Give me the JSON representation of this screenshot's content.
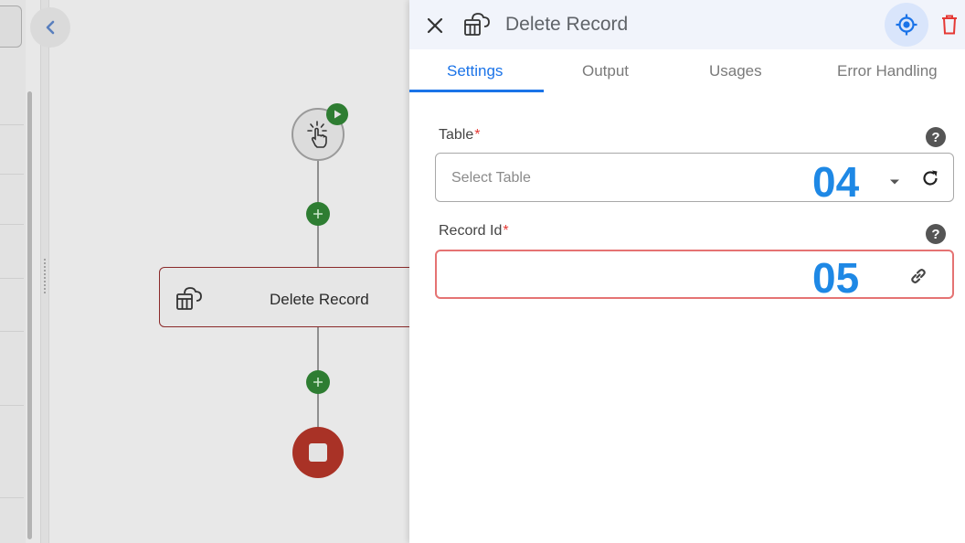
{
  "canvas": {
    "step_node_label": "Delete Record",
    "icons": [
      "chevron-left-icon",
      "tap-hand-icon",
      "play-icon",
      "plus-icon",
      "cloud-table-icon",
      "stop-icon"
    ]
  },
  "panel": {
    "title": "Delete Record",
    "tabs": [
      {
        "label": "Settings",
        "active": true
      },
      {
        "label": "Output",
        "active": false
      },
      {
        "label": "Usages",
        "active": false
      },
      {
        "label": "Error Handling",
        "active": false
      }
    ],
    "fields": {
      "table": {
        "label": "Table",
        "required_marker": "*",
        "placeholder": "Select Table",
        "annotation": "04"
      },
      "record_id": {
        "label": "Record Id",
        "required_marker": "*",
        "value": "",
        "annotation": "05"
      }
    },
    "help_glyph": "?",
    "icons": [
      "close-icon",
      "cloud-table-icon",
      "locate-icon",
      "trash-icon",
      "dropdown-caret-icon",
      "refresh-icon",
      "link-icon",
      "help-icon"
    ]
  },
  "colors": {
    "accent": "#1a73e8",
    "danger": "#e53935",
    "success": "#2e7d32",
    "stop": "#a93226",
    "annotation": "#1e88e5"
  }
}
